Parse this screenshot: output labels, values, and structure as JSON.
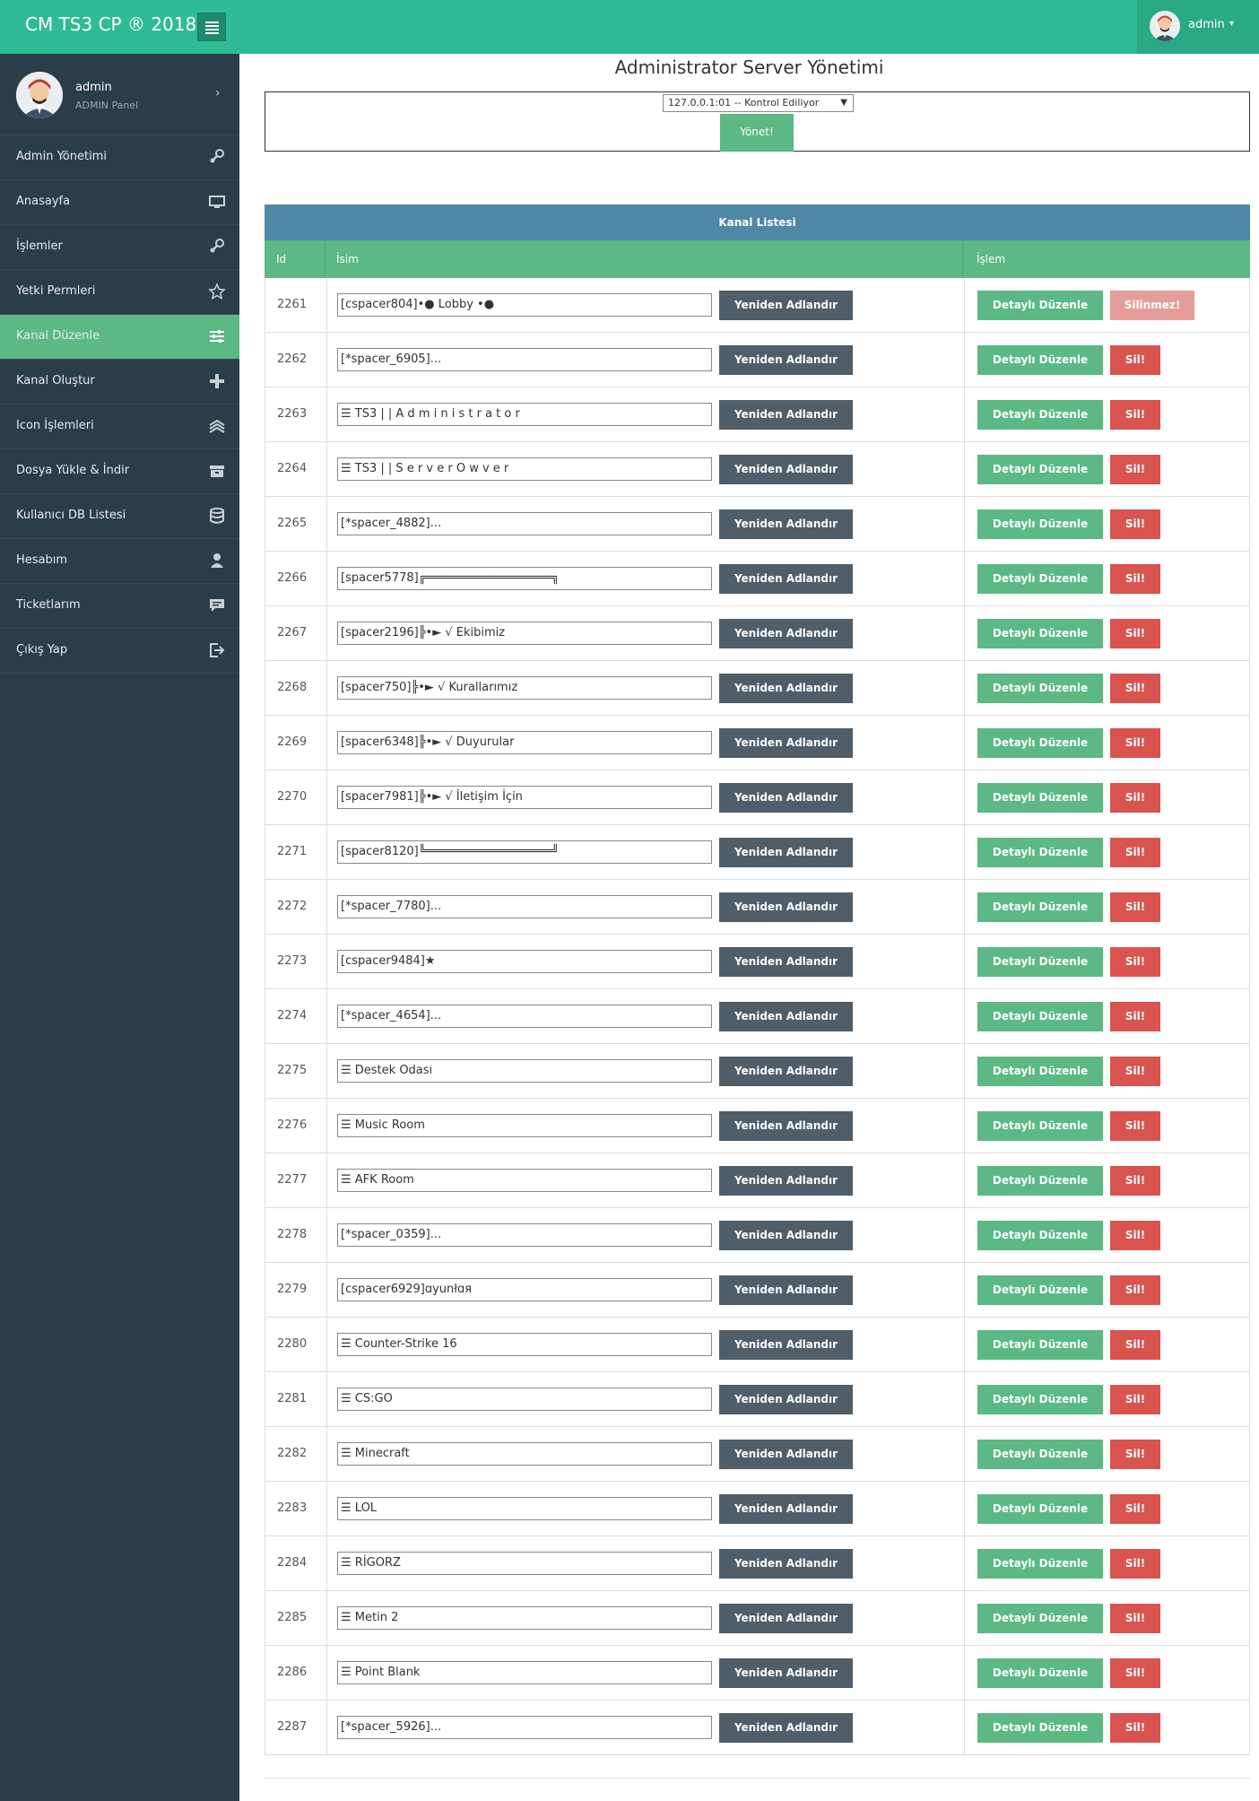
{
  "header": {
    "brand": "CM TS3 CP ® 2018",
    "user_name": "admin",
    "caret": "▾"
  },
  "sidebar": {
    "profile_name": "admin",
    "profile_role": "ADMIN Panel",
    "items": [
      {
        "label": "Admin Yönetimi",
        "icon": "keys-icon"
      },
      {
        "label": "Anasayfa",
        "icon": "monitor-icon"
      },
      {
        "label": "İşlemler",
        "icon": "keys-icon"
      },
      {
        "label": "Yetki Permleri",
        "icon": "star-icon"
      },
      {
        "label": "Kanal Düzenle",
        "icon": "sliders-icon",
        "active": true
      },
      {
        "label": "Kanal Oluştur",
        "icon": "plus-icon"
      },
      {
        "label": "Icon İşlemleri",
        "icon": "layers-icon"
      },
      {
        "label": "Dosya Yükle & İndir",
        "icon": "archive-icon"
      },
      {
        "label": "Kullanıcı DB Listesi",
        "icon": "database-icon"
      },
      {
        "label": "Hesabım",
        "icon": "user-icon"
      },
      {
        "label": "Ticketlarım",
        "icon": "chat-icon"
      },
      {
        "label": "Çıkış Yap",
        "icon": "sign-out-icon"
      }
    ]
  },
  "main": {
    "title": "Administrator Server Yönetimi",
    "server_select": "127.0.0.1:01 -- Kontrol Ediliyor",
    "manage_button": "Yönet!",
    "panel_title": "Kanal Listesi",
    "columns": {
      "id": "Id",
      "name": "İsim",
      "action": "İşlem"
    },
    "rename_label": "Yeniden Adlandır",
    "detail_label": "Detaylı Düzenle",
    "delete_label": "Sil!",
    "cant_delete_label": "Silinmez!",
    "rows": [
      {
        "id": "2261",
        "name": "[cspacer804]•● Lobby •●",
        "locked": true
      },
      {
        "id": "2262",
        "name": "[*spacer_6905]..."
      },
      {
        "id": "2263",
        "name": "☰ TS3 | | A d m i n i s t r a t o r"
      },
      {
        "id": "2264",
        "name": "☰ TS3 | | S e r v e r O w v e r"
      },
      {
        "id": "2265",
        "name": "[*spacer_4882]..."
      },
      {
        "id": "2266",
        "name": "[spacer5778]╔══════════════════╗"
      },
      {
        "id": "2267",
        "name": "[spacer2196]╠•► √ Ekibimiz"
      },
      {
        "id": "2268",
        "name": "[spacer750]╠•► √ Kurallarımız"
      },
      {
        "id": "2269",
        "name": "[spacer6348]╠•► √ Duyurular"
      },
      {
        "id": "2270",
        "name": "[spacer7981]╠•► √ İletişim İçin"
      },
      {
        "id": "2271",
        "name": "[spacer8120]╚══════════════════╝"
      },
      {
        "id": "2272",
        "name": "[*spacer_7780]..."
      },
      {
        "id": "2273",
        "name": "[cspacer9484]★"
      },
      {
        "id": "2274",
        "name": "[*spacer_4654]..."
      },
      {
        "id": "2275",
        "name": "☰ Destek Odası"
      },
      {
        "id": "2276",
        "name": "☰ Music Room"
      },
      {
        "id": "2277",
        "name": "☰ AFK Room"
      },
      {
        "id": "2278",
        "name": "[*spacer_0359]..."
      },
      {
        "id": "2279",
        "name": "[cspacer6929]ɑyunłɑя"
      },
      {
        "id": "2280",
        "name": "☰ Counter-Strike 16"
      },
      {
        "id": "2281",
        "name": "☰ CS:GO"
      },
      {
        "id": "2282",
        "name": "☰ Minecraft"
      },
      {
        "id": "2283",
        "name": "☰ LOL"
      },
      {
        "id": "2284",
        "name": "☰ RİGORZ"
      },
      {
        "id": "2285",
        "name": "☰ Metin 2"
      },
      {
        "id": "2286",
        "name": "☰ Point Blank"
      },
      {
        "id": "2287",
        "name": "[*spacer_5926]..."
      }
    ]
  }
}
